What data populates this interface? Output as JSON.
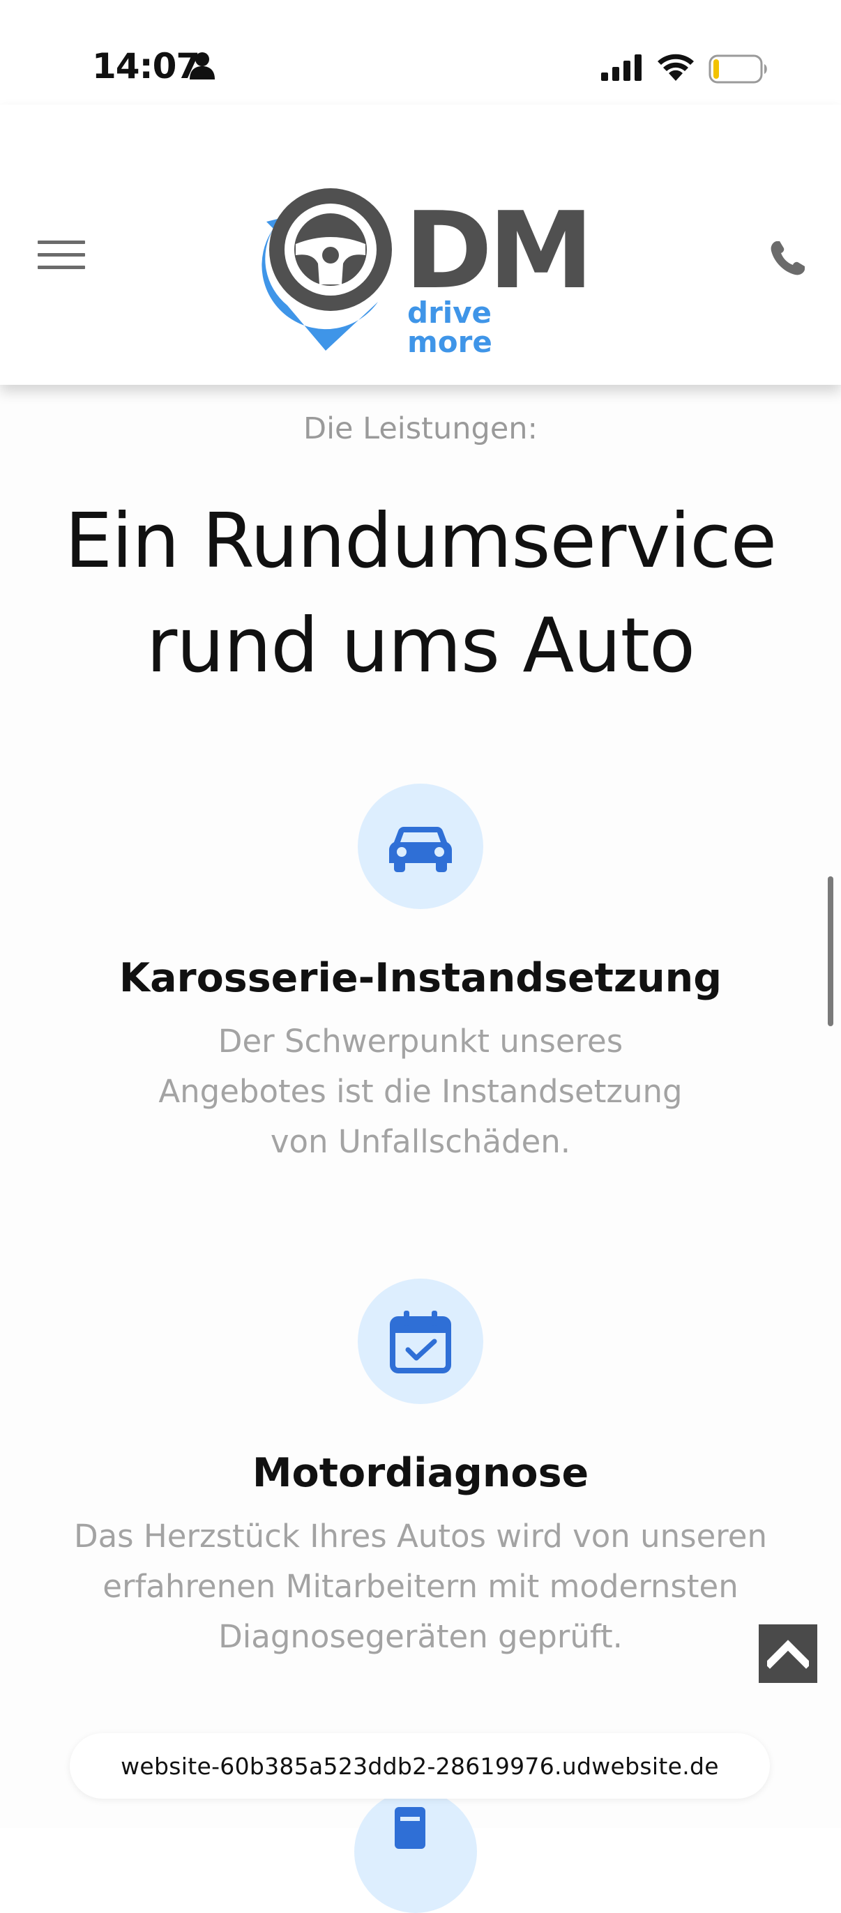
{
  "status_bar": {
    "time": "14:07"
  },
  "header": {
    "logo": {
      "mark": "DM",
      "tagline": "drive more"
    },
    "icons": {
      "menu": "hamburger-menu-icon",
      "phone": "phone-icon"
    }
  },
  "main": {
    "eyebrow": "Die Leistungen:",
    "headline_line1": "Ein Rundumservice",
    "headline_line2": "rund ums Auto",
    "services": [
      {
        "icon": "car-icon",
        "title": "Karosserie-Instandsetzung",
        "desc_lines": [
          "Der Schwerpunkt unseres",
          "Angebotes ist die Instandsetzung",
          "von Unfallschäden."
        ]
      },
      {
        "icon": "calendar-check-icon",
        "title": "Motordiagnose",
        "desc_lines": [
          "Das Herzstück Ihres Autos wird von unseren",
          "erfahrenen Mitarbeitern mit modernsten",
          "Diagnosegeräten geprüft."
        ]
      }
    ]
  },
  "browser": {
    "url": "website-60b385a523ddb2-28619976.udwebsite.de"
  },
  "colors": {
    "accent_blue": "#2f6fd6",
    "icon_circle": "#ddeefe",
    "logo_blue": "#3f95e8",
    "logo_gray": "#505050",
    "muted_text": "#a3a3a3"
  }
}
